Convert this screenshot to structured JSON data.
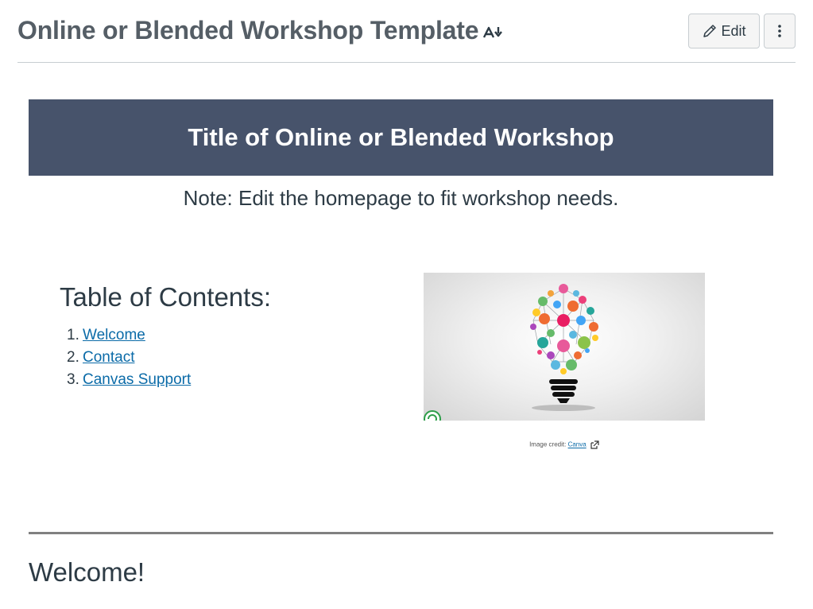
{
  "header": {
    "title": "Online or Blended Workshop Template",
    "edit_label": "Edit",
    "accessibility_icon": "accessibility-checker-icon",
    "edit_icon": "pencil-icon",
    "more_icon": "more-vertical-icon"
  },
  "banner": {
    "title": "Title of Online or Blended Workshop",
    "background": "#47536b"
  },
  "note": "Note: Edit the homepage to fit workshop needs.",
  "toc": {
    "heading": "Table of Contents:",
    "items": [
      {
        "number": "1.",
        "label": "Welcome"
      },
      {
        "number": "2.",
        "label": "Contact"
      },
      {
        "number": "3.",
        "label": "Canvas Support"
      }
    ]
  },
  "image": {
    "subject": "lightbulb-network-illustration",
    "credit_prefix": "Image credit:",
    "credit_link": "Canva",
    "external_icon": "external-link-icon"
  },
  "section": {
    "welcome_heading": "Welcome!"
  },
  "colors": {
    "link": "#0b6ba8",
    "text": "#2d3b45",
    "title_gray": "#555e66"
  }
}
